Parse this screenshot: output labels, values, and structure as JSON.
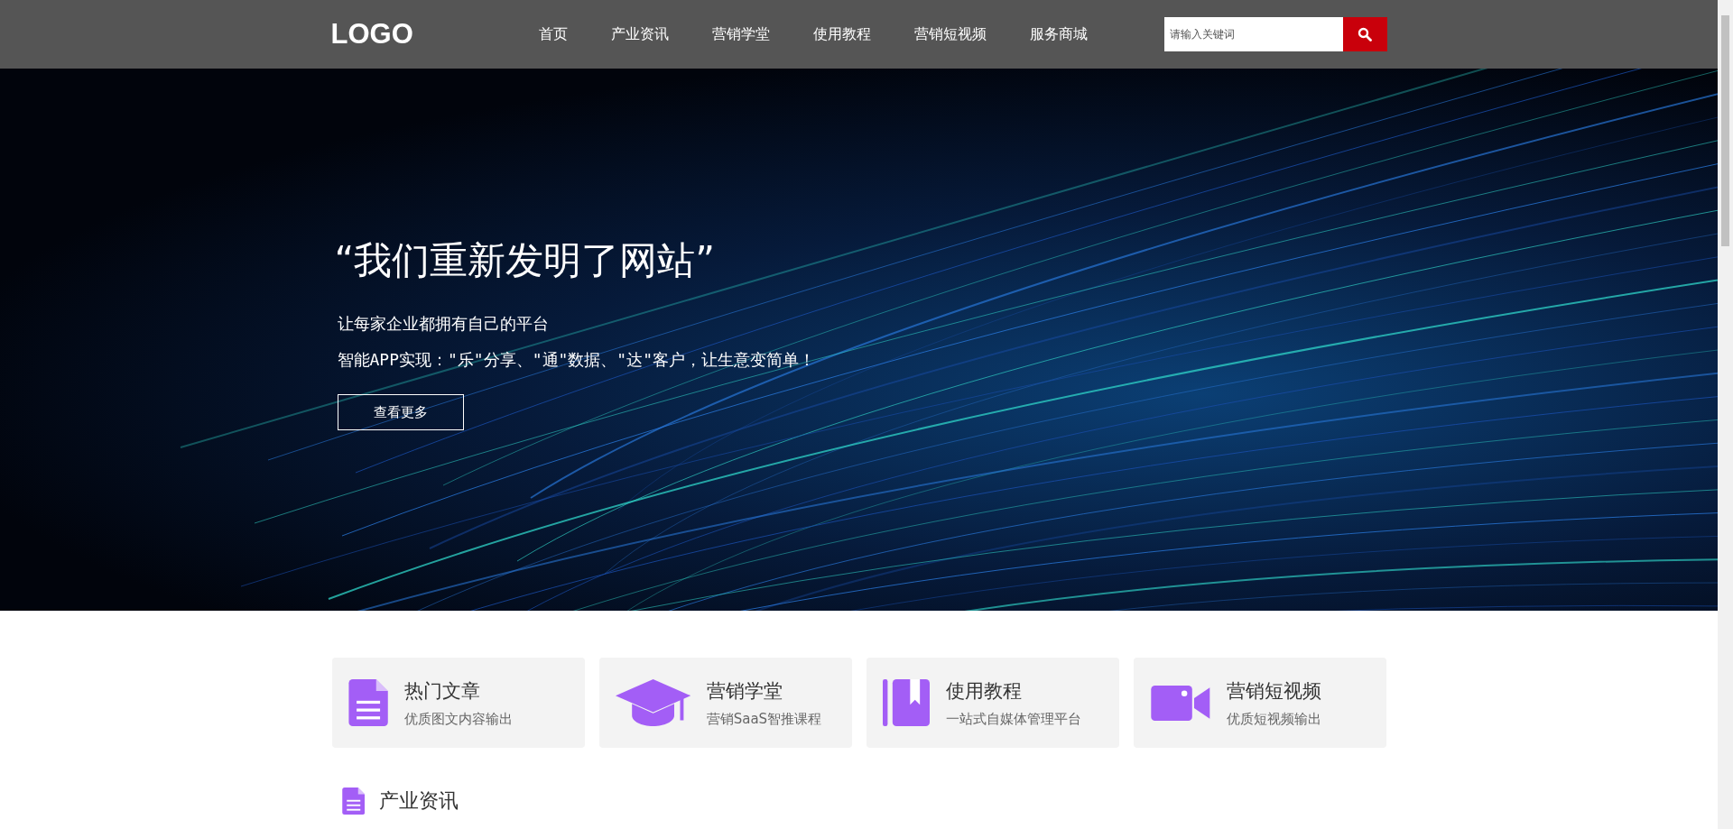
{
  "header": {
    "logo": "LOGO",
    "nav": [
      {
        "label": "首页"
      },
      {
        "label": "产业资讯"
      },
      {
        "label": "营销学堂"
      },
      {
        "label": "使用教程"
      },
      {
        "label": "营销短视频"
      },
      {
        "label": "服务商城"
      }
    ],
    "search": {
      "placeholder": "请输入关键词"
    }
  },
  "hero": {
    "title": "“我们重新发明了网站”",
    "subtitle": "让每家企业都拥有自己的平台",
    "tagline": "智能APP实现：\"乐\"分享、\"通\"数据、\"达\"客户，让生意变简单！",
    "button": "查看更多"
  },
  "features": [
    {
      "kind": "document",
      "title": "热门文章",
      "desc": "优质图文内容输出"
    },
    {
      "kind": "cap",
      "title": "营销学堂",
      "desc": "营销SaaS智推课程"
    },
    {
      "kind": "book",
      "title": "使用教程",
      "desc": "一站式自媒体管理平台"
    },
    {
      "kind": "video",
      "title": "营销短视频",
      "desc": "优质短视频输出"
    }
  ],
  "section": {
    "kind": "document",
    "title": "产业资讯"
  }
}
